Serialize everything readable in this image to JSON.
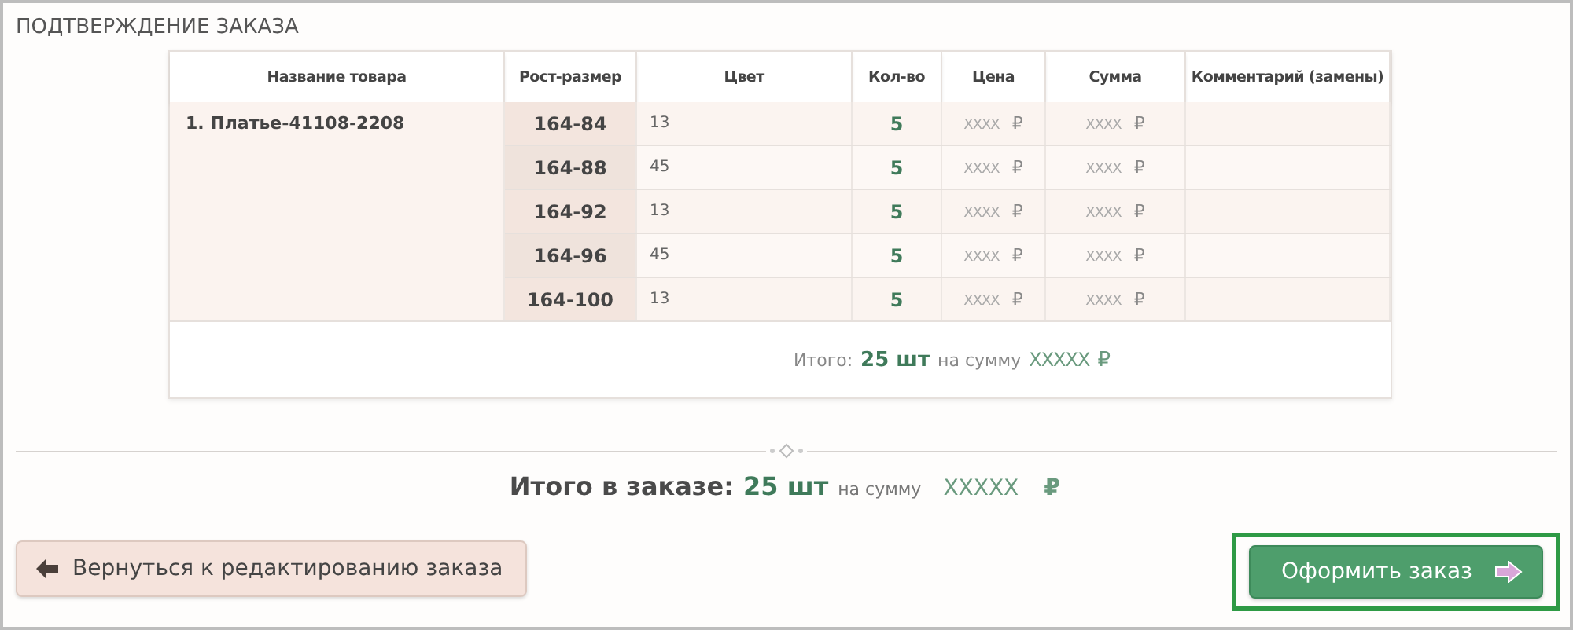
{
  "title": "ПОДТВЕРЖДЕНИЕ ЗАКАЗА",
  "table": {
    "columns": [
      "Название товара",
      "Рост-размер",
      "Цвет",
      "Кол-во",
      "Цена",
      "Сумма",
      "Комментарий (замены)"
    ],
    "product": "1. Платье-41108-2208",
    "rows": [
      {
        "size": "164-84",
        "color_code": "13",
        "qty": "5",
        "price": "XXXX",
        "price_currency": "₽",
        "sum": "XXXX",
        "sum_currency": "₽"
      },
      {
        "size": "164-88",
        "color_code": "45",
        "qty": "5",
        "price": "XXXX",
        "price_currency": "₽",
        "sum": "XXXX",
        "sum_currency": "₽"
      },
      {
        "size": "164-92",
        "color_code": "13",
        "qty": "5",
        "price": "XXXX",
        "price_currency": "₽",
        "sum": "XXXX",
        "sum_currency": "₽"
      },
      {
        "size": "164-96",
        "color_code": "45",
        "qty": "5",
        "price": "XXXX",
        "price_currency": "₽",
        "sum": "XXXX",
        "sum_currency": "₽"
      },
      {
        "size": "164-100",
        "color_code": "13",
        "qty": "5",
        "price": "XXXX",
        "price_currency": "₽",
        "sum": "XXXX",
        "sum_currency": "₽"
      }
    ],
    "subtotal": {
      "label": "Итого:",
      "count": "25 шт",
      "sum_label": "на сумму",
      "sum": "XXXXX",
      "currency": "₽"
    }
  },
  "order_total": {
    "label": "Итого в заказе:",
    "count": "25 шт",
    "sum_label": "на сумму",
    "sum": "XXXXX",
    "currency": "₽"
  },
  "buttons": {
    "back": "Вернуться к редактированию заказа",
    "checkout": "Оформить заказ"
  }
}
